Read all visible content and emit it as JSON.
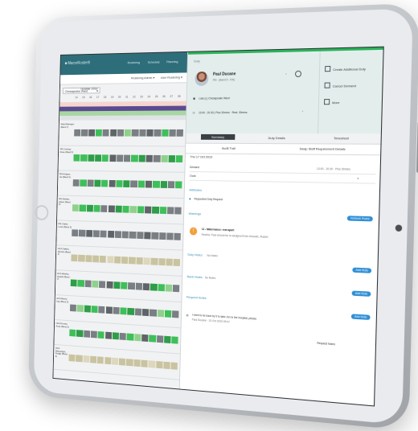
{
  "app": {
    "brand": "■ MacroRoster®",
    "nav": [
      "Rostering",
      "Schedule",
      "Planning"
    ],
    "subtabs": [
      "Rostering Admin ▾",
      "User Rostering ▾"
    ],
    "location_select": "Chesapeake Ward",
    "month": "October 2019",
    "days": [
      "14",
      "15",
      "16",
      "17",
      "18",
      "19",
      "20",
      "21",
      "22",
      "23",
      "24",
      "25",
      "26",
      "27",
      "28"
    ]
  },
  "roster_rows": [
    {
      "label": "Ward Manager (Band 7)"
    },
    {
      "label": "RN Conway Rose (Band 5)"
    },
    {
      "label": "RN Hodges, Jet (Band 5)"
    },
    {
      "label": "RN Webley, Alison (Band 5)"
    },
    {
      "label": "RN Clarke, Louis (Band 5)"
    },
    {
      "label": "HCA Oakley, Tamara (Band 2)"
    },
    {
      "label": "HCA Webley, Angela (Band 3)"
    },
    {
      "label": "HCA Brand, Kay (Band 3)"
    },
    {
      "label": "HCA Dorsey, Amie (Band 3)"
    },
    {
      "label": "HCA Wainwright, Dodge (Band 3)"
    }
  ],
  "panel": {
    "section": "Duty",
    "name": "Paul Ducane",
    "role": "RN - (Band 5 - RN)",
    "shift_type": "Late (L) Chesapeake Ward",
    "shift_time": "13:00 - 20:30 | Plus 30mins · Rest: 30mins",
    "actions": [
      "Create Additional Duty",
      "Cancel Demand",
      "More"
    ],
    "tabs": [
      "Summary",
      "Duty Details",
      "Timesheet"
    ],
    "subtabs": [
      "Audit Trail",
      "Swap Staff Requirement Details"
    ],
    "date": "Thu 17 Oct 2019",
    "demand_label": "Demand",
    "demand_value": "13:00 - 20:30 · Plus 30mins",
    "clock_label": "Clock",
    "attributes_label": "Attributes",
    "requested": "Requested Duty Request",
    "warnings_label": "Warnings",
    "refresh_btn": "Refresh Rules",
    "warning_title": "11 - Maternance: rest apart",
    "warning_text": "Review: Paul should be re-assigned from Ancoats, Ruskin",
    "duty_notes_label": "Duty Notes",
    "duty_notes_value": "No Notes",
    "add_note_btn": "Add Note",
    "bank_notes_label": "Bank Notes",
    "bank_notes_value": "No Notes",
    "add_note_btn2": "Add Note",
    "request_notes_label": "Request Notes",
    "add_note_btn3": "Add Note",
    "request_note_text": "I need to be back by 9 to take Jon to the hospital, please",
    "request_note_meta": "Paul Ducane · 10 Oct 2019 09:47",
    "request_notes_footer": "Request Notes"
  },
  "colors": {
    "accent_green": "#2bb35a",
    "header_teal": "#2e6e7a",
    "button_blue": "#2f8fd6",
    "warning_orange": "#f0a03a"
  }
}
